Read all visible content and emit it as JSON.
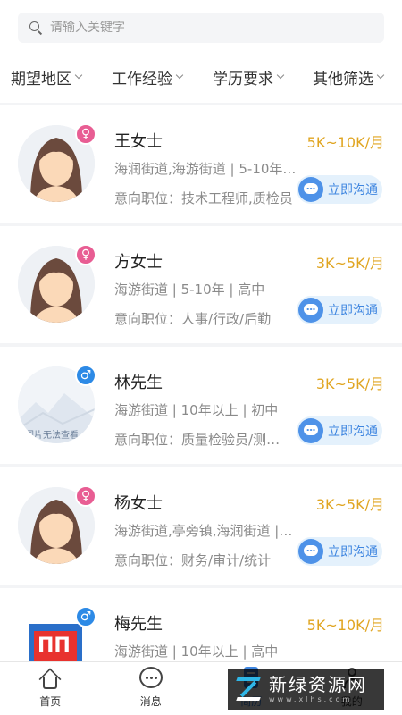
{
  "search": {
    "placeholder": "请输入关键字"
  },
  "filters": [
    {
      "label": "期望地区"
    },
    {
      "label": "工作经验"
    },
    {
      "label": "学历要求"
    },
    {
      "label": "其他筛选"
    }
  ],
  "candidates": [
    {
      "name": "王女士",
      "gender": "female",
      "salary": "5K~10K/月",
      "location": "海润街道,海游街道 | 5-10年 | 高中",
      "job": "意向职位：技术工程师,质检员",
      "avatar": "female-avatar"
    },
    {
      "name": "方女士",
      "gender": "female",
      "salary": "3K~5K/月",
      "location": "海游街道 | 5-10年 | 高中",
      "job": "意向职位：人事/行政/后勤",
      "avatar": "female-avatar"
    },
    {
      "name": "林先生",
      "gender": "male",
      "salary": "3K~5K/月",
      "location": "海游街道 | 10年以上 | 初中",
      "job": "意向职位：质量检验员/测试员",
      "avatar": "broken-photo",
      "avatar_text": "图片无法查看"
    },
    {
      "name": "杨女士",
      "gender": "female",
      "salary": "3K~5K/月",
      "location": "海游街道,亭旁镇,海润街道 | 3-5年",
      "job": "意向职位：财务/审计/统计",
      "avatar": "female-avatar"
    },
    {
      "name": "梅先生",
      "gender": "male",
      "salary": "5K~10K/月",
      "location": "海游街道 | 10年以上 | 高中",
      "job": "意向职位：",
      "avatar": "logo-photo",
      "avatar_text": "ПП"
    }
  ],
  "chat_label": "立即沟通",
  "gender_icons": {
    "female": "♀",
    "male": "♂"
  },
  "tabs": [
    {
      "label": "首页",
      "icon": "home-icon"
    },
    {
      "label": "消息",
      "icon": "message-icon"
    },
    {
      "label": "简历",
      "icon": "resume-icon",
      "active": true
    },
    {
      "label": "我的",
      "icon": "profile-icon"
    }
  ],
  "watermark": {
    "title": "新绿资源网",
    "url": "www.xlhs.com"
  },
  "colors": {
    "salary": "#e0a521",
    "accent": "#3f86e0",
    "female": "#e85d93",
    "male": "#2d8ae6"
  }
}
